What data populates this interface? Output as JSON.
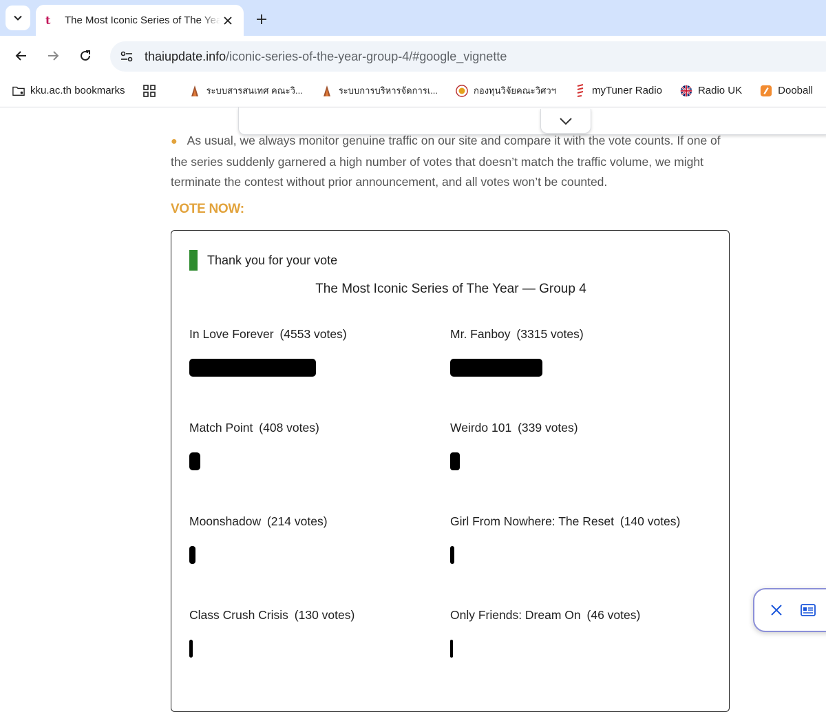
{
  "browser": {
    "tab": {
      "title": "The Most Iconic Series of The Year — Group 4",
      "favicon": "t"
    },
    "url": {
      "host": "thaiupdate.info",
      "path": "/iconic-series-of-the-year-group-4/#google_vignette"
    },
    "bookmarks": [
      {
        "label": "kku.ac.th bookmarks",
        "icon": "folder-icon"
      },
      {
        "label": "",
        "icon": "apps-grid-icon"
      },
      {
        "label": "ระบบสารสนเทศ คณะวิ...",
        "icon": "flame-icon"
      },
      {
        "label": "ระบบการบริหารจัดการเ...",
        "icon": "flame-icon"
      },
      {
        "label": "กองทุนวิจัยคณะวิศวฯ",
        "icon": "seal-icon"
      },
      {
        "label": "myTuner Radio",
        "icon": "radio-icon"
      },
      {
        "label": "Radio UK",
        "icon": "uk-flag-icon"
      },
      {
        "label": "Dooball",
        "icon": "dooball-icon"
      }
    ]
  },
  "page": {
    "bullet": "As usual, we always monitor genuine traffic on our site and compare it with the vote counts. If one of the series suddenly garnered a high number of votes that doesn’t match the traffic volume, we might terminate the contest without prior announcement, and all votes won’t be counted.",
    "vote_now": "VOTE NOW:",
    "poll": {
      "thanks": "Thank you for your vote",
      "title": "The Most Iconic Series of The Year — Group 4",
      "max_votes": 4553,
      "entries": [
        {
          "name": "In Love Forever",
          "count_text": "(4553 votes)",
          "votes": 4553
        },
        {
          "name": "Mr. Fanboy",
          "count_text": "(3315 votes)",
          "votes": 3315
        },
        {
          "name": "Match Point",
          "count_text": "(408 votes)",
          "votes": 408
        },
        {
          "name": "Weirdo 101",
          "count_text": "(339 votes)",
          "votes": 339
        },
        {
          "name": "Moonshadow",
          "count_text": "(214 votes)",
          "votes": 214
        },
        {
          "name": "Girl From Nowhere: The Reset",
          "count_text": "(140 votes)",
          "votes": 140
        },
        {
          "name": "Class Crush Crisis",
          "count_text": "(130 votes)",
          "votes": 130
        },
        {
          "name": "Only Friends: Dream On",
          "count_text": "(46 votes)",
          "votes": 46
        }
      ]
    }
  },
  "colors": {
    "accent": "#e2a33c",
    "thanks_bar": "#2e8b2e",
    "tabstrip": "#d3e3fd",
    "bar": "#000000"
  }
}
